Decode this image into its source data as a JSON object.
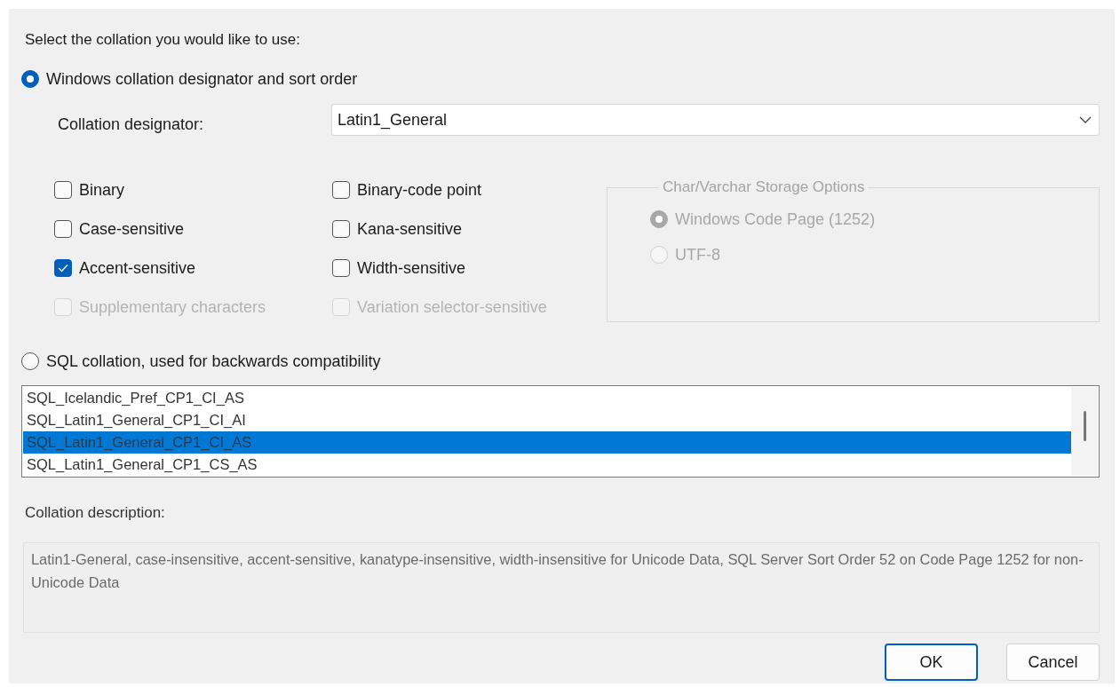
{
  "prompt": "Select the collation you would like to use:",
  "windows_option": {
    "label": "Windows collation designator and sort order",
    "selected": true
  },
  "collation_designator": {
    "label": "Collation designator:",
    "value": "Latin1_General"
  },
  "checkboxes": [
    {
      "label": "Binary",
      "checked": false,
      "disabled": false
    },
    {
      "label": "Binary-code point",
      "checked": false,
      "disabled": false
    },
    {
      "label": "Case-sensitive",
      "checked": false,
      "disabled": false
    },
    {
      "label": "Kana-sensitive",
      "checked": false,
      "disabled": false
    },
    {
      "label": "Accent-sensitive",
      "checked": true,
      "disabled": false
    },
    {
      "label": "Width-sensitive",
      "checked": false,
      "disabled": false
    },
    {
      "label": "Supplementary characters",
      "checked": false,
      "disabled": true
    },
    {
      "label": "Variation selector-sensitive",
      "checked": false,
      "disabled": true
    }
  ],
  "storage_options": {
    "title": "Char/Varchar Storage Options",
    "options": [
      {
        "label": "Windows Code Page (1252)",
        "selected": true,
        "disabled": true
      },
      {
        "label": "UTF-8",
        "selected": false,
        "disabled": true
      }
    ]
  },
  "sql_option": {
    "label": "SQL collation, used for backwards compatibility",
    "selected": false
  },
  "sql_collations": [
    {
      "label": "SQL_Icelandic_Pref_CP1_CI_AS",
      "selected": false
    },
    {
      "label": "SQL_Latin1_General_CP1_CI_AI",
      "selected": false
    },
    {
      "label": "SQL_Latin1_General_CP1_CI_AS",
      "selected": true
    },
    {
      "label": "SQL_Latin1_General_CP1_CS_AS",
      "selected": false
    }
  ],
  "description": {
    "label": "Collation description:",
    "text": "Latin1-General, case-insensitive, accent-sensitive, kanatype-insensitive, width-insensitive for Unicode Data, SQL Server Sort Order 52 on Code Page 1252 for non-Unicode Data"
  },
  "buttons": [
    {
      "label": "OK",
      "default": true
    },
    {
      "label": "Cancel",
      "default": false
    }
  ]
}
